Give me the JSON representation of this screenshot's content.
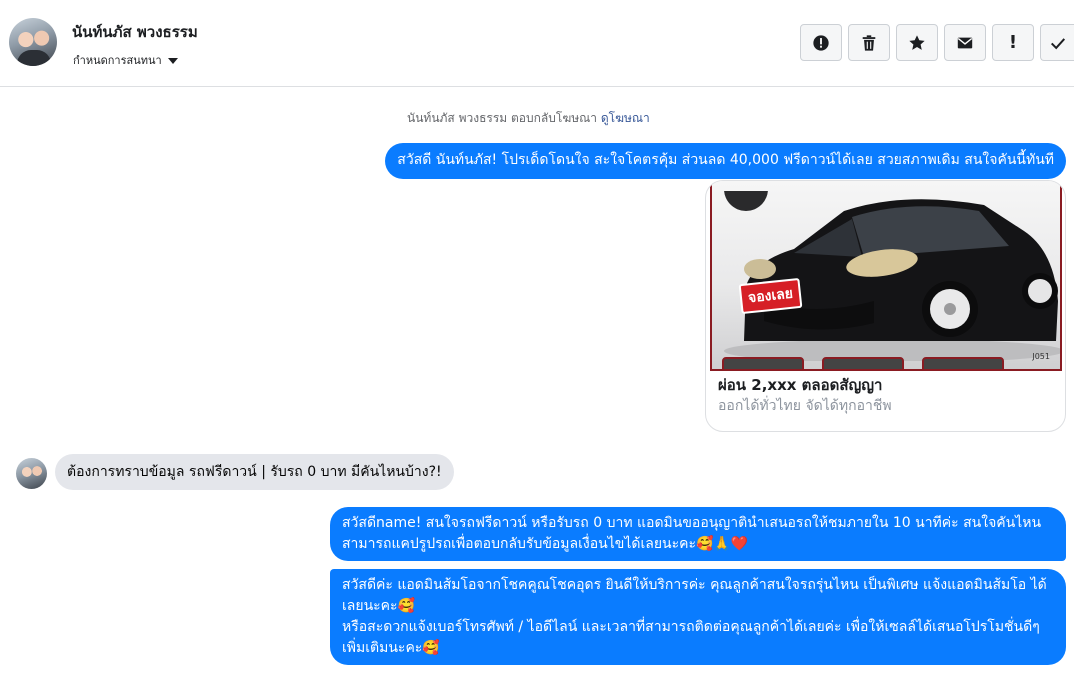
{
  "header": {
    "contact_name": "นันท์นภัส พวงธรรม",
    "conversation_setting": "กำหนดการสนทนา",
    "actions": [
      {
        "icon": "alert-circle-icon"
      },
      {
        "icon": "trash-icon"
      },
      {
        "icon": "star-icon"
      },
      {
        "icon": "mail-icon"
      },
      {
        "icon": "exclamation-icon",
        "label": "!"
      },
      {
        "icon": "check-icon"
      }
    ]
  },
  "thread": {
    "ad_reply_text": "นันท์นภัส พวงธรรม ตอบกลับโฆษณา",
    "ad_reply_link": "ดูโฆษณา",
    "outgoing_1": "สวัสดี นันท์นภัส! โปรเด็ดโดนใจ สะใจโคตรคุ้ม ส่วนลด 40,000 ฟรีดาวน์ได้เลย สวยสภาพเดิม สนใจคันนี้ทันที",
    "ad_card": {
      "stamp": "จองเลย",
      "stock_code": "J051",
      "title": "ผ่อน 2,xxx ตลอดสัญญา",
      "subtitle": "ออกได้ทั่วไทย จัดได้ทุกอาชีพ"
    },
    "incoming_1": "ต้องการทราบข้อมูล รถฟรีดาวน์ | รับรถ 0 บาท มีคันไหนบ้าง?!",
    "outgoing_2": "สวัสดีname! สนใจรถฟรีดาวน์ หรือรับรถ 0 บาท แอดมินขออนุญาตินำเสนอรถให้ชมภายใน 10 นาทีค่ะ สนใจคันไหนสามารถแคปรูปรถเพื่อตอบกลับรับข้อมูลเงื่อนไขได้เลยนะคะ🥰🙏❤️",
    "outgoing_3": "สวัสดีค่ะ แอดมินส้มโอจากโชคคูณโชคอุดร ยินดีให้บริการค่ะ   คุณลูกค้าสนใจรถรุ่นไหน เป็นพิเศษ แจ้งแอดมินส้มโอ ได้เลยนะคะ🥰\nหรือสะดวกแจ้งเบอร์โทรศัพท์ / ไอดีไลน์ และเวลาที่สามารถติดต่อคุณลูกค้าได้เลยค่ะ เพื่อให้เซลล์ได้เสนอโปรโมชั่นดีๆเพิ่มเติมนะคะ🥰"
  },
  "colors": {
    "outgoing_bubble": "#0a7cff",
    "incoming_bubble": "#e4e6eb",
    "link": "#385898"
  }
}
